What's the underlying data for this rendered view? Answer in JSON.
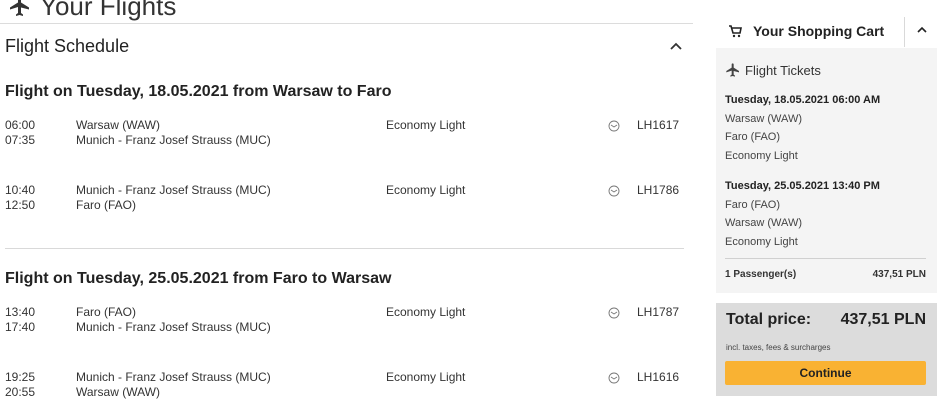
{
  "page": {
    "title": "Your Flights",
    "title_icon": "airplane-icon"
  },
  "schedule": {
    "title": "Flight Schedule",
    "flights": [
      {
        "heading": "Flight on Tuesday, 18.05.2021 from Warsaw to Faro",
        "segments": [
          {
            "dep_time": "06:00",
            "arr_time": "07:35",
            "from": "Warsaw (WAW)",
            "to": "Munich - Franz Josef Strauss (MUC)",
            "cabin": "Economy Light",
            "flight_no": "LH1617"
          },
          {
            "dep_time": "10:40",
            "arr_time": "12:50",
            "from": "Munich - Franz Josef Strauss (MUC)",
            "to": "Faro (FAO)",
            "cabin": "Economy Light",
            "flight_no": "LH1786"
          }
        ]
      },
      {
        "heading": "Flight on Tuesday, 25.05.2021 from Faro to Warsaw",
        "segments": [
          {
            "dep_time": "13:40",
            "arr_time": "17:40",
            "from": "Faro (FAO)",
            "to": "Munich - Franz Josef Strauss (MUC)",
            "cabin": "Economy Light",
            "flight_no": "LH1787"
          },
          {
            "dep_time": "19:25",
            "arr_time": "20:55",
            "from": "Munich - Franz Josef Strauss (MUC)",
            "to": "Warsaw (WAW)",
            "cabin": "Economy Light",
            "flight_no": "LH1616"
          }
        ]
      }
    ]
  },
  "cart": {
    "title": "Your Shopping Cart",
    "section_label": "Flight Tickets",
    "trips": [
      {
        "datetime": "Tuesday, 18.05.2021 06:00 AM",
        "from": "Warsaw (WAW)",
        "to": "Faro (FAO)",
        "fare": "Economy Light"
      },
      {
        "datetime": "Tuesday, 25.05.2021 13:40 PM",
        "from": "Faro (FAO)",
        "to": "Warsaw (WAW)",
        "fare": "Economy Light"
      }
    ],
    "passengers_label": "1 Passenger(s)",
    "passengers_price": "437,51 PLN",
    "total_label": "Total price:",
    "total_value": "437,51 PLN",
    "tax_note": "incl. taxes, fees & surcharges",
    "continue_label": "Continue"
  },
  "colors": {
    "accent": "#f9b233",
    "panel_bg": "#f4f4f4",
    "total_bg": "#dcdcdc"
  }
}
